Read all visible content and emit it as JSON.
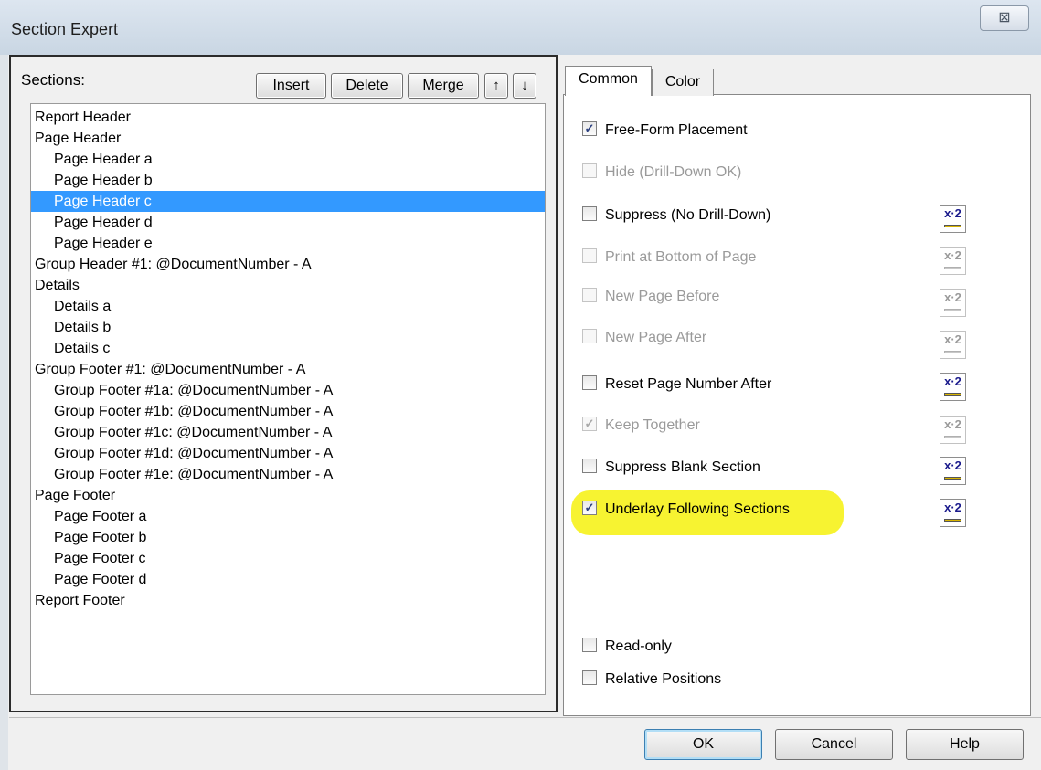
{
  "window": {
    "title": "Section Expert",
    "close_glyph": "⊠"
  },
  "left": {
    "sections_label": "Sections:",
    "buttons": {
      "insert": "Insert",
      "delete": "Delete",
      "merge": "Merge",
      "up": "↑",
      "down": "↓"
    },
    "items": [
      {
        "label": "Report Header",
        "indent": false,
        "selected": false
      },
      {
        "label": "Page Header",
        "indent": false,
        "selected": false
      },
      {
        "label": "Page Header a",
        "indent": true,
        "selected": false
      },
      {
        "label": "Page Header b",
        "indent": true,
        "selected": false
      },
      {
        "label": "Page Header c",
        "indent": true,
        "selected": true
      },
      {
        "label": "Page Header d",
        "indent": true,
        "selected": false
      },
      {
        "label": "Page Header e",
        "indent": true,
        "selected": false
      },
      {
        "label": "Group Header #1: @DocumentNumber - A",
        "indent": false,
        "selected": false
      },
      {
        "label": "Details",
        "indent": false,
        "selected": false
      },
      {
        "label": "Details a",
        "indent": true,
        "selected": false
      },
      {
        "label": "Details b",
        "indent": true,
        "selected": false
      },
      {
        "label": "Details c",
        "indent": true,
        "selected": false
      },
      {
        "label": "Group Footer #1: @DocumentNumber - A",
        "indent": false,
        "selected": false
      },
      {
        "label": "Group Footer #1a: @DocumentNumber - A",
        "indent": true,
        "selected": false
      },
      {
        "label": "Group Footer #1b: @DocumentNumber - A",
        "indent": true,
        "selected": false
      },
      {
        "label": "Group Footer #1c: @DocumentNumber - A",
        "indent": true,
        "selected": false
      },
      {
        "label": "Group Footer #1d: @DocumentNumber - A",
        "indent": true,
        "selected": false
      },
      {
        "label": "Group Footer #1e: @DocumentNumber - A",
        "indent": true,
        "selected": false
      },
      {
        "label": "Page Footer",
        "indent": false,
        "selected": false
      },
      {
        "label": "Page Footer a",
        "indent": true,
        "selected": false
      },
      {
        "label": "Page Footer b",
        "indent": true,
        "selected": false
      },
      {
        "label": "Page Footer c",
        "indent": true,
        "selected": false
      },
      {
        "label": "Page Footer d",
        "indent": true,
        "selected": false
      },
      {
        "label": "Report Footer",
        "indent": false,
        "selected": false
      }
    ],
    "selected_color": "#3399ff"
  },
  "tabs": {
    "common": "Common",
    "color": "Color"
  },
  "options": {
    "free_form_placement": {
      "label": "Free-Form Placement",
      "checked": true,
      "enabled": true
    },
    "hide_drill_down_ok": {
      "label": "Hide (Drill-Down OK)",
      "checked": false,
      "enabled": false
    },
    "suppress_no_drill_down": {
      "label": "Suppress (No Drill-Down)",
      "checked": false,
      "enabled": true
    },
    "print_at_bottom_of_page": {
      "label": "Print at Bottom of Page",
      "checked": false,
      "enabled": false
    },
    "new_page_before": {
      "label": "New Page Before",
      "checked": false,
      "enabled": false
    },
    "new_page_after": {
      "label": "New Page After",
      "checked": false,
      "enabled": false
    },
    "reset_page_number_after": {
      "label": "Reset Page Number After",
      "checked": false,
      "enabled": true
    },
    "keep_together": {
      "label": "Keep Together",
      "checked": true,
      "enabled": false
    },
    "suppress_blank_section": {
      "label": "Suppress Blank Section",
      "checked": false,
      "enabled": true
    },
    "underlay_following_sections": {
      "label": "Underlay Following Sections",
      "checked": true,
      "enabled": true
    },
    "read_only": {
      "label": "Read-only",
      "checked": false,
      "enabled": true
    },
    "relative_positions": {
      "label": "Relative Positions",
      "checked": false,
      "enabled": true
    }
  },
  "formula_button_text": "x·2",
  "check_glyph": "✓",
  "highlight_color": "#f7f331",
  "footer": {
    "ok": "OK",
    "cancel": "Cancel",
    "help": "Help"
  }
}
